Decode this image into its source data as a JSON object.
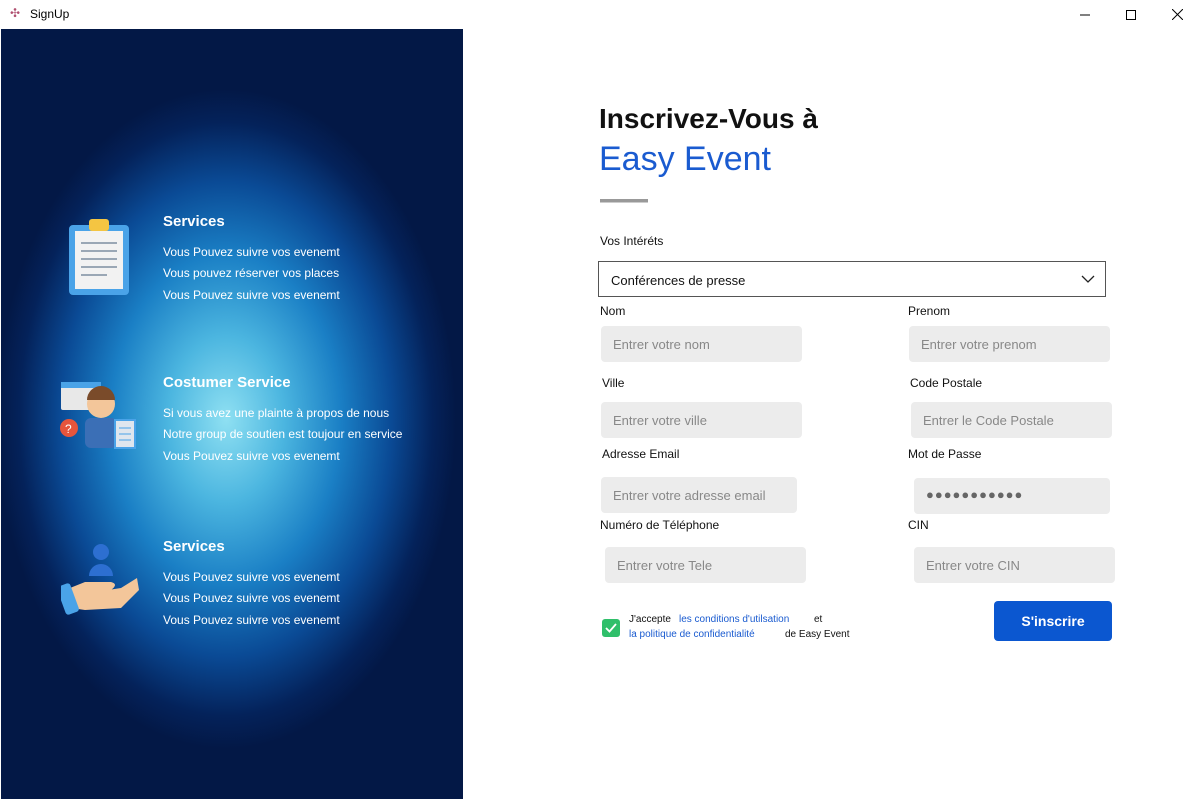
{
  "window": {
    "title": "SignUp"
  },
  "left": {
    "sections": [
      {
        "title": "Services",
        "lines": [
          "Vous Pouvez suivre vos evenemt",
          "Vous pouvez réserver vos places",
          "Vous Pouvez suivre vos evenemt"
        ],
        "icon": "clipboard-icon"
      },
      {
        "title": "Costumer Service",
        "lines": [
          "Si vous avez une plainte à propos de nous",
          "Notre group de soutien est toujour en service",
          "Vous Pouvez suivre vos evenemt"
        ],
        "icon": "customer-support-icon"
      },
      {
        "title": "Services",
        "lines": [
          "Vous Pouvez suivre vos evenemt",
          "Vous Pouvez suivre vos evenemt",
          "Vous Pouvez suivre vos evenemt"
        ],
        "icon": "hand-user-icon"
      }
    ]
  },
  "form": {
    "heading_line1": "Inscrivez-Vous à",
    "heading_line2": "Easy Event",
    "interests_label": "Vos Intéréts",
    "interests_value": "Conférences de presse",
    "nom_label": "Nom",
    "nom_placeholder": "Entrer votre nom",
    "prenom_label": "Prenom",
    "prenom_placeholder": "Entrer votre prenom",
    "ville_label": "Ville",
    "ville_placeholder": "Entrer votre ville",
    "code_label": "Code Postale",
    "code_placeholder": "Entrer le Code Postale",
    "email_label": "Adresse Email",
    "email_placeholder": "Entrer votre adresse email",
    "password_label": "Mot de Passe",
    "password_value": "●●●●●●●●●●●",
    "tel_label": "Numéro de Téléphone",
    "tel_placeholder": "Entrer votre Tele",
    "cin_label": "CIN",
    "cin_placeholder": "Entrer votre CIN",
    "accept_text": "J'accepte",
    "terms_link": "les conditions d'utilsation",
    "and_text": "et",
    "privacy_link": "la politique de confidentialité",
    "of_text": "de Easy Event",
    "submit_label": "S'inscrire",
    "accent_color": "#0b57d0",
    "checkbox_color": "#2fbf6a"
  }
}
